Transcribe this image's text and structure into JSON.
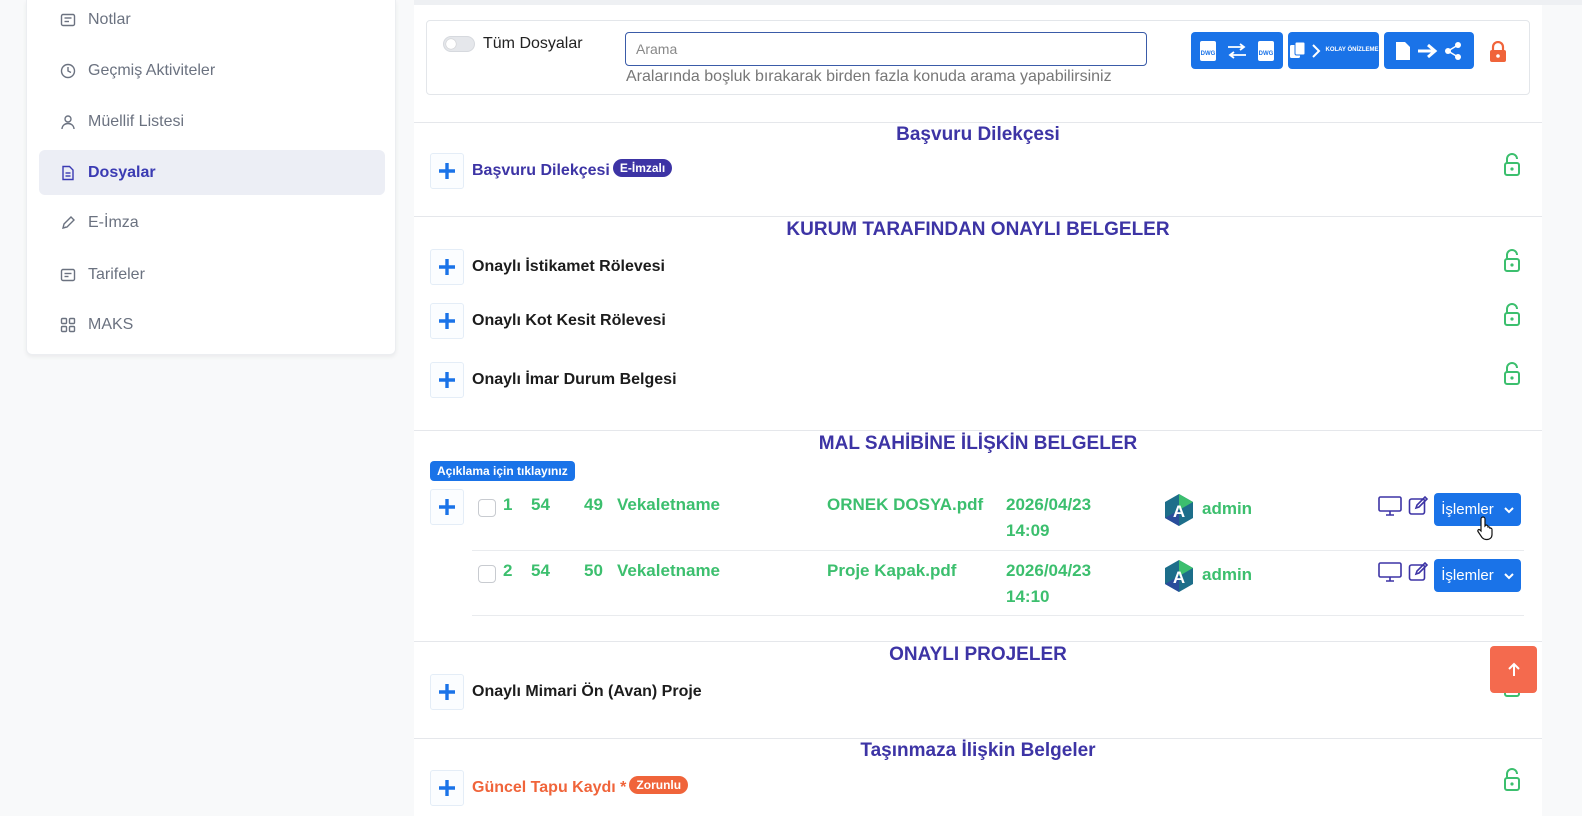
{
  "sidebar": {
    "items": [
      {
        "label": "Notlar",
        "icon": "notes-icon"
      },
      {
        "label": "Geçmiş Aktiviteler",
        "icon": "clock-icon"
      },
      {
        "label": "Müellif Listesi",
        "icon": "user-icon"
      },
      {
        "label": "Dosyalar",
        "icon": "file-icon",
        "active": true
      },
      {
        "label": "E-İmza",
        "icon": "pen-icon"
      },
      {
        "label": "Tarifeler",
        "icon": "message-icon"
      },
      {
        "label": "MAKS",
        "icon": "grid-icon"
      }
    ]
  },
  "search": {
    "toggle_label": "Tüm Dosyalar",
    "placeholder": "Arama",
    "hint": "Aralarında boşluk bırakarak birden fazla konuda arama yapabilirsiniz"
  },
  "toolbar": {
    "dwg_convert": "dwg-convert-icon",
    "easy_preview": "KOLAY ÖNİZLEME",
    "share": "share-icon",
    "lock": "lock-icon"
  },
  "sections": [
    {
      "title": "Başvuru Dilekçesi",
      "rows": [
        {
          "label": "Başvuru Dilekçesi",
          "badge": "E-İmzalı"
        }
      ]
    },
    {
      "title": "KURUM TARAFINDAN ONAYLI BELGELER",
      "rows": [
        {
          "label": "Onaylı İstikamet Rölevesi"
        },
        {
          "label": "Onaylı Kot Kesit Rölevesi"
        },
        {
          "label": "Onaylı İmar Durum Belgesi"
        }
      ]
    },
    {
      "title": "MAL SAHİBİNE İLİŞKİN BELGELER",
      "hint_tag": "Açıklama için tıklayınız",
      "files": [
        {
          "no": "1",
          "a": "54",
          "b": "49",
          "type": "Vekaletname",
          "name": "ORNEK DOSYA.pdf",
          "date": "2026/04/23",
          "time": "14:09",
          "user": "admin",
          "action": "İşlemler"
        },
        {
          "no": "2",
          "a": "54",
          "b": "50",
          "type": "Vekaletname",
          "name": "Proje Kapak.pdf",
          "date": "2026/04/23",
          "time": "14:10",
          "user": "admin",
          "action": "İşlemler"
        }
      ]
    },
    {
      "title": "ONAYLI PROJELER",
      "rows": [
        {
          "label": "Onaylı Mimari Ön (Avan) Proje"
        }
      ]
    },
    {
      "title": "Taşınmaza İlişkin Belgeler",
      "rows": [
        {
          "label": "Güncel Tapu Kaydı *",
          "badge": "Zorunlu"
        }
      ]
    }
  ],
  "colors": {
    "primary": "#1a73e8",
    "title": "#3d34a5",
    "green": "#3cbf6e",
    "orange": "#f0643a"
  }
}
